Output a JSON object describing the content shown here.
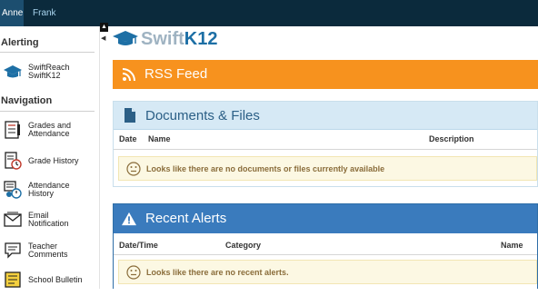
{
  "topbar": {
    "tabs": [
      {
        "label": "Anne",
        "active": true
      },
      {
        "label": "Frank",
        "active": false
      }
    ]
  },
  "sidebar": {
    "alerting_title": "Alerting",
    "alerting_items": [
      {
        "label_line1": "SwiftReach",
        "label_line2": "SwiftK12",
        "icon": "graduation-cap-icon"
      }
    ],
    "navigation_title": "Navigation",
    "nav_items": [
      {
        "label_line1": "Grades and",
        "label_line2": "Attendance",
        "icon": "gradebook-icon"
      },
      {
        "label_line1": "Grade History",
        "label_line2": "",
        "icon": "grade-history-icon"
      },
      {
        "label_line1": "Attendance",
        "label_line2": "History",
        "icon": "attendance-history-icon"
      },
      {
        "label_line1": "Email",
        "label_line2": "Notification",
        "icon": "email-icon"
      },
      {
        "label_line1": "Teacher",
        "label_line2": "Comments",
        "icon": "comment-icon"
      },
      {
        "label_line1": "School Bulletin",
        "label_line2": "",
        "icon": "bulletin-icon"
      }
    ]
  },
  "logo": {
    "part1": "Swift",
    "part2": "K12"
  },
  "rss": {
    "title": "RSS Feed",
    "color": "#f7921e"
  },
  "documents": {
    "title": "Documents & Files",
    "columns": [
      "Date",
      "Name",
      "Description"
    ],
    "empty_message": "Looks like there are no documents or files currently available"
  },
  "alerts": {
    "title": "Recent Alerts",
    "columns": [
      "Date/Time",
      "Category",
      "Name"
    ],
    "empty_message": "Looks like there are no recent alerts.",
    "color": "#3a7bbd"
  }
}
